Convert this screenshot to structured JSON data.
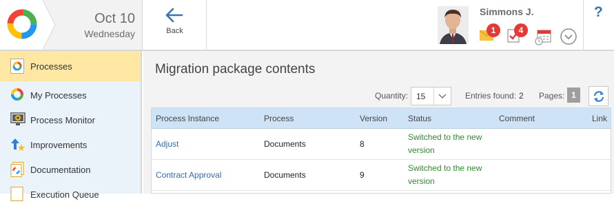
{
  "header": {
    "date_day": "Oct 10",
    "date_weekday": "Wednesday",
    "back_label": "Back",
    "user_name": "Simmons J.",
    "messages_count": "1",
    "tasks_count": "4",
    "help_label": "?"
  },
  "sidebar": {
    "items": [
      {
        "label": "Processes"
      },
      {
        "label": "My Processes"
      },
      {
        "label": "Process Monitor"
      },
      {
        "label": "Improvements"
      },
      {
        "label": "Documentation"
      },
      {
        "label": "Execution Queue"
      }
    ]
  },
  "main": {
    "title": "Migration package contents",
    "quantity_label": "Quantity:",
    "quantity_value": "15",
    "entries_label": "Entries found:",
    "entries_value": "2",
    "pages_label": "Pages:",
    "pages_value": "1",
    "columns": [
      "Process Instance",
      "Process",
      "Version",
      "Status",
      "Comment",
      "Link"
    ],
    "rows": [
      {
        "instance": "Adjust",
        "process": "Documents",
        "version": "8",
        "status": "Switched to the new version",
        "comment": "",
        "link": ""
      },
      {
        "instance": "Contract Approval",
        "process": "Documents",
        "version": "9",
        "status": "Switched to the new version",
        "comment": "",
        "link": ""
      }
    ]
  },
  "colors": {
    "accent": "#3a72b5",
    "active_sidebar": "#fde7a3",
    "status_green": "#2e8b2e",
    "badge_red": "#e53935"
  }
}
